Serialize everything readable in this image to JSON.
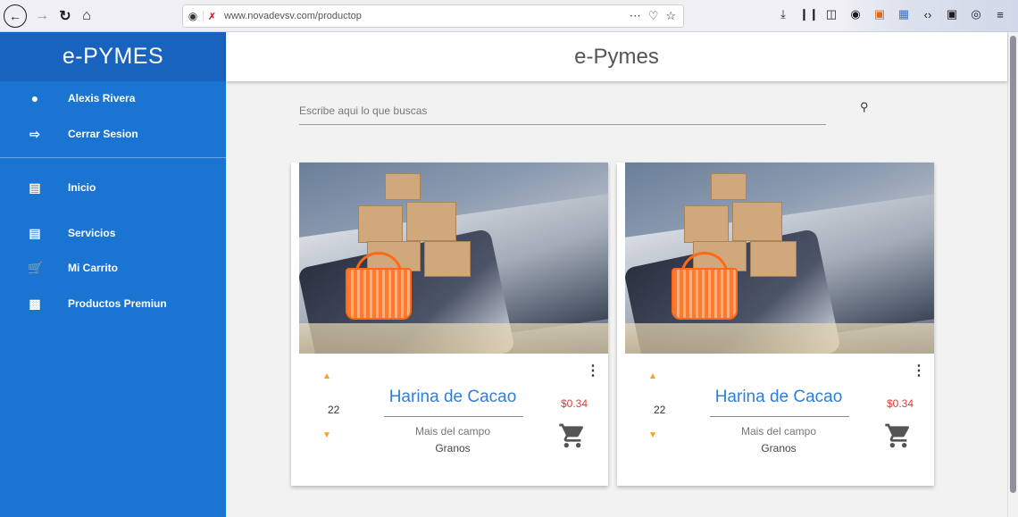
{
  "browser": {
    "url": "www.novadevsv.com/productop",
    "icons": {
      "back": "back-arrow-icon",
      "forward": "forward-arrow-icon",
      "reload": "reload-icon",
      "home": "home-icon",
      "shield": "tracking-shield-icon",
      "insecure": "insecure-lock-icon",
      "page_actions": "more-actions-icon",
      "bookmark": "bookmark-star-icon",
      "downloads": "download-icon",
      "library": "library-icon",
      "sidebar": "sidebar-toggle-icon",
      "account": "account-icon",
      "menu": "hamburger-menu-icon"
    }
  },
  "sidebar": {
    "brand": "e-PYMES",
    "user": {
      "label": "Alexis Rivera",
      "icon": "account-circle-icon"
    },
    "logout": {
      "label": "Cerrar Sesion",
      "icon": "logout-icon"
    },
    "items": [
      {
        "label": "Inicio",
        "icon": "briefcase-icon"
      },
      {
        "label": "Servicios",
        "icon": "briefcase-icon"
      },
      {
        "label": "Mi Carrito",
        "icon": "cart-add-icon"
      },
      {
        "label": "Productos Premiun",
        "icon": "gift-card-icon"
      }
    ]
  },
  "main": {
    "title": "e-Pymes",
    "search": {
      "placeholder": "Escribe aqui lo que buscas",
      "value": ""
    },
    "products": [
      {
        "name": "Harina de Cacao",
        "brand": "Mais del campo",
        "category": "Granos",
        "price": "$0.34",
        "quantity": "22"
      },
      {
        "name": "Harina de Cacao",
        "brand": "Mais del campo",
        "category": "Granos",
        "price": "$0.34",
        "quantity": "22"
      }
    ]
  },
  "colors": {
    "sidebar": "#1a74d2",
    "sidebar_header": "#1763be",
    "product_name": "#2f7fd8",
    "price": "#e53935",
    "quantity_arrows": "#ff9f1a"
  }
}
